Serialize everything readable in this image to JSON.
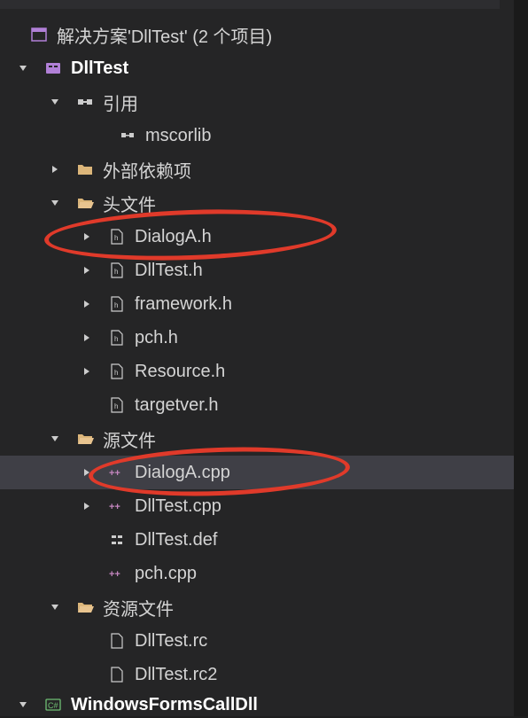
{
  "solution": {
    "label": "解决方案'DllTest' (2 个项目)"
  },
  "project1": {
    "name": "DllTest",
    "references": {
      "label": "引用",
      "items": [
        "mscorlib"
      ]
    },
    "external_deps": "外部依赖项",
    "headers": {
      "label": "头文件",
      "files": [
        "DialogA.h",
        "DllTest.h",
        "framework.h",
        "pch.h",
        "Resource.h",
        "targetver.h"
      ]
    },
    "sources": {
      "label": "源文件",
      "files": [
        "DialogA.cpp",
        "DllTest.cpp",
        "DllTest.def",
        "pch.cpp"
      ]
    },
    "resources": {
      "label": "资源文件",
      "files": [
        "DllTest.rc",
        "DllTest.rc2"
      ]
    }
  },
  "project2": {
    "name": "WindowsFormsCallDll"
  },
  "annotations": {
    "circle1_target": "DialogA.h",
    "circle2_target": "DialogA.cpp"
  }
}
